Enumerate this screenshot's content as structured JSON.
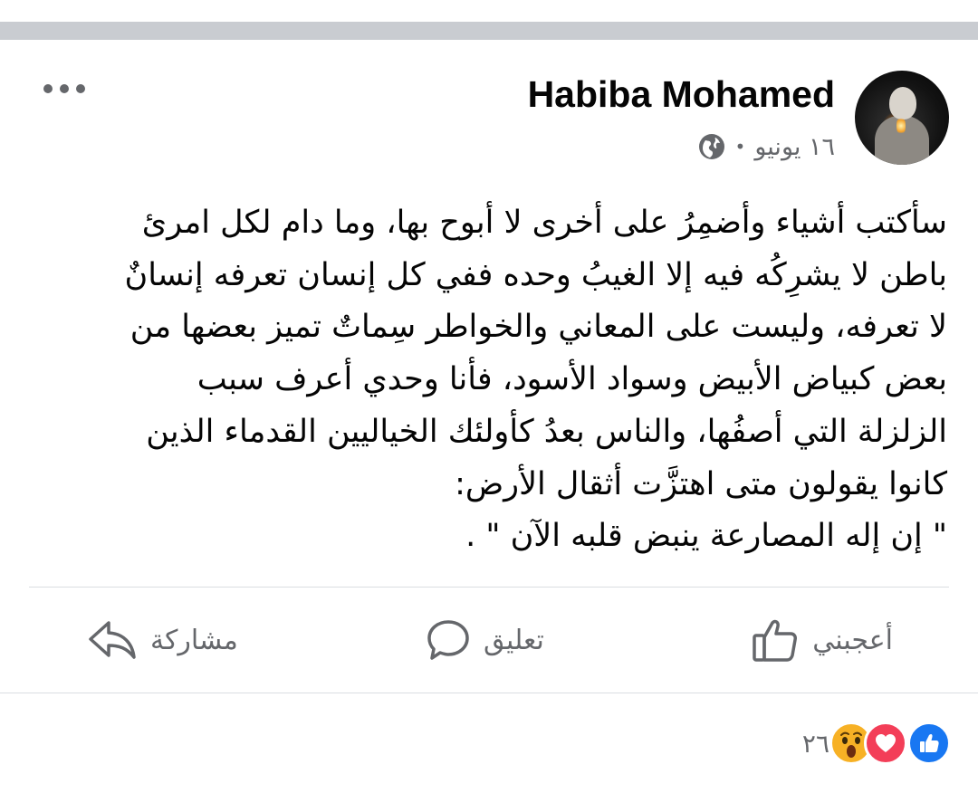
{
  "post": {
    "author": "Habiba Mohamed",
    "date": "١٦ يونيو",
    "separator": "•",
    "privacy_icon": "globe-icon",
    "text_lines": [
      "سأكتب أشياء وأضمِرُ على أخرى لا أبوح بها، وما دام لكل امرئ",
      "باطن لا يشرِكُه فيه إلا الغيبُ وحده ففي كل إنسان تعرفه إنسانٌ",
      "لا تعرفه، وليست على المعاني والخواطر سِماتٌ تميز بعضها من",
      "بعض كبياض الأبيض وسواد الأسود، فأنا وحدي أعرف سبب",
      "الزلزلة التي أصفُها، والناس بعدُ كأولئك الخياليين القدماء الذين",
      "كانوا يقولون متى اهتزَّت أثقال الأرض:",
      "\" إن إله المصارعة ينبض قلبه الآن \" ."
    ]
  },
  "actions": {
    "like_label": "أعجبني",
    "comment_label": "تعليق",
    "share_label": "مشاركة"
  },
  "reactions": {
    "count": "٢٦",
    "types": [
      "like",
      "love",
      "wow"
    ]
  },
  "colors": {
    "text": "#050505",
    "secondary": "#65676b",
    "like_blue": "#1877f2",
    "love_red": "#f33e58",
    "wow_yellow": "#f7b125",
    "divider": "#dadde1"
  }
}
